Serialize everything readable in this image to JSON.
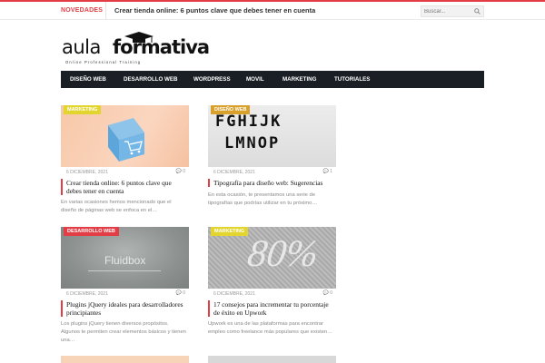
{
  "topbar": {
    "novedades": "NOVEDADES",
    "ticker": "Crear tienda online: 6 puntos clave que debes tener en cuenta",
    "search_placeholder": "Buscar..."
  },
  "logo": {
    "part1": "aula",
    "part2": "formativa",
    "tagline": "Online Professional Training"
  },
  "nav": {
    "items": [
      "DISEÑO WEB",
      "DESARROLLO WEB",
      "WORDPRESS",
      "MOVIL",
      "MARKETING",
      "TUTORIALES"
    ]
  },
  "colors": {
    "accent": "#e33d45",
    "marketing": "#e2d530",
    "diseno": "#d9a12b",
    "desarrollo": "#e33d45",
    "nav_bg": "#1a1f25"
  },
  "posts": [
    {
      "category": "MARKETING",
      "date": "6 DICIEMBRE, 2021",
      "comments": "0",
      "title": "Crear tienda online: 6 puntos clave que debes tener en cuenta",
      "excerpt": "En varias ocasiones hemos mencionado que el diseño de páginas web se enfoca en el…"
    },
    {
      "category": "DISEÑO WEB",
      "date": "6 DICIEMBRE, 2021",
      "comments": "1",
      "title": "Tipografía para diseño web: Sugerencias",
      "excerpt": "En esta ocasión, te presentamos una serie de tipografías que podrías utilizar en tu próximo…",
      "thumb_text1": "FGHIJK",
      "thumb_text2": "LMNOP"
    },
    {
      "category": "DESARROLLO WEB",
      "date": "6 DICIEMBRE, 2021",
      "comments": "0",
      "title": "Plugins jQuery ideales para desarrolladores principiantes",
      "excerpt": "Los plugins jQuery tienen diversos propósitos. Algunos te permiten crear elementos básicos y tienen una…",
      "thumb_text": "Fluidbox"
    },
    {
      "category": "MARKETING",
      "date": "6 DICIEMBRE, 2021",
      "comments": "0",
      "title": "17 consejos para incrementar tu porcentaje de éxito en Upwork",
      "excerpt": "Upwork es una de las plataformas para encontrar empleo como freelance más populares que existen…",
      "thumb_text": "80%"
    }
  ]
}
